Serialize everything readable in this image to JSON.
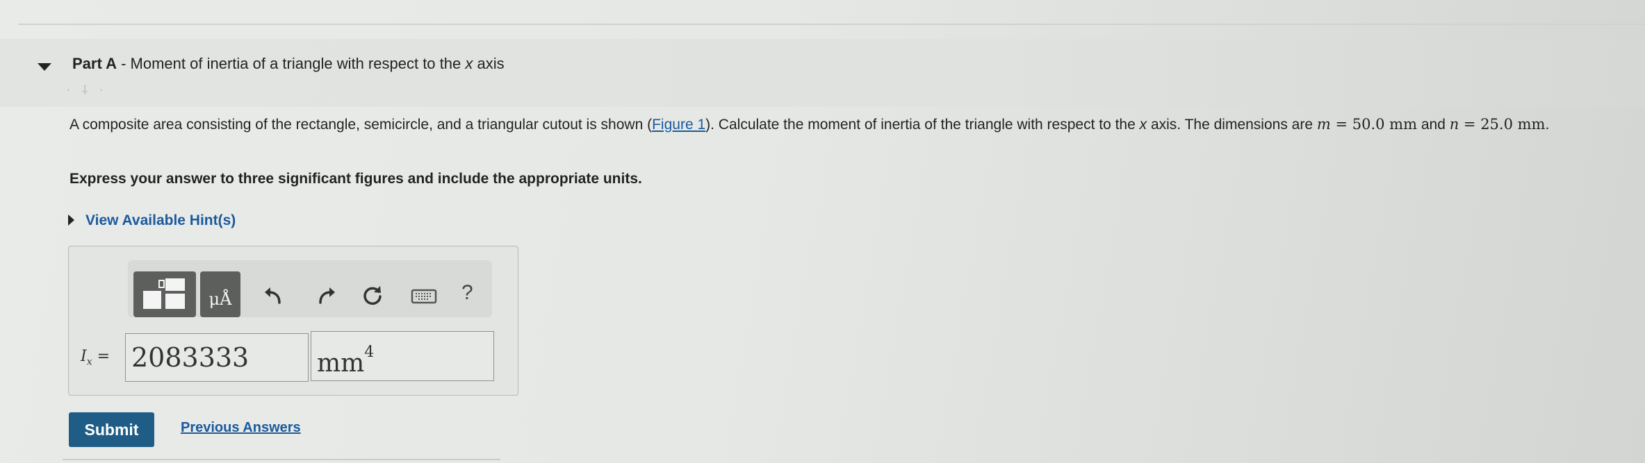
{
  "part": {
    "label": "Part A",
    "separator": " - ",
    "title_before_axis": "Moment of inertia of a triangle with respect to the ",
    "axis": "x",
    "title_after_axis": " axis"
  },
  "question": {
    "text_1": "A composite area consisting of the rectangle, semicircle, and a triangular cutout is shown (",
    "figure_link": "Figure 1",
    "text_2": "). Calculate the moment of inertia of the triangle with respect to the ",
    "axis": "x",
    "text_3": " axis. The dimensions are ",
    "m_var": "m",
    "m_value": " = 50.0 mm",
    "text_4": " and ",
    "n_var": "n",
    "n_value": " = 25.0 mm",
    "text_5": "."
  },
  "instruction": "Express your answer to three significant figures and include the appropriate units.",
  "hints_label": "View Available Hint(s)",
  "toolbar": {
    "units_label": "μÅ",
    "help_label": "?",
    "icons": [
      "templates-icon",
      "units-icon",
      "undo-icon",
      "redo-icon",
      "reset-icon",
      "keyboard-icon",
      "help-icon"
    ]
  },
  "answer": {
    "variable": "I",
    "subscript": "x",
    "equals": " =",
    "value": "2083333",
    "unit": "mm",
    "unit_exponent": "4"
  },
  "actions": {
    "submit": "Submit",
    "previous_answers": "Previous Answers"
  },
  "colors": {
    "link": "#1a5a9c",
    "submit_bg": "#1f5c86",
    "toolbar_button": "#5d5f5d"
  }
}
